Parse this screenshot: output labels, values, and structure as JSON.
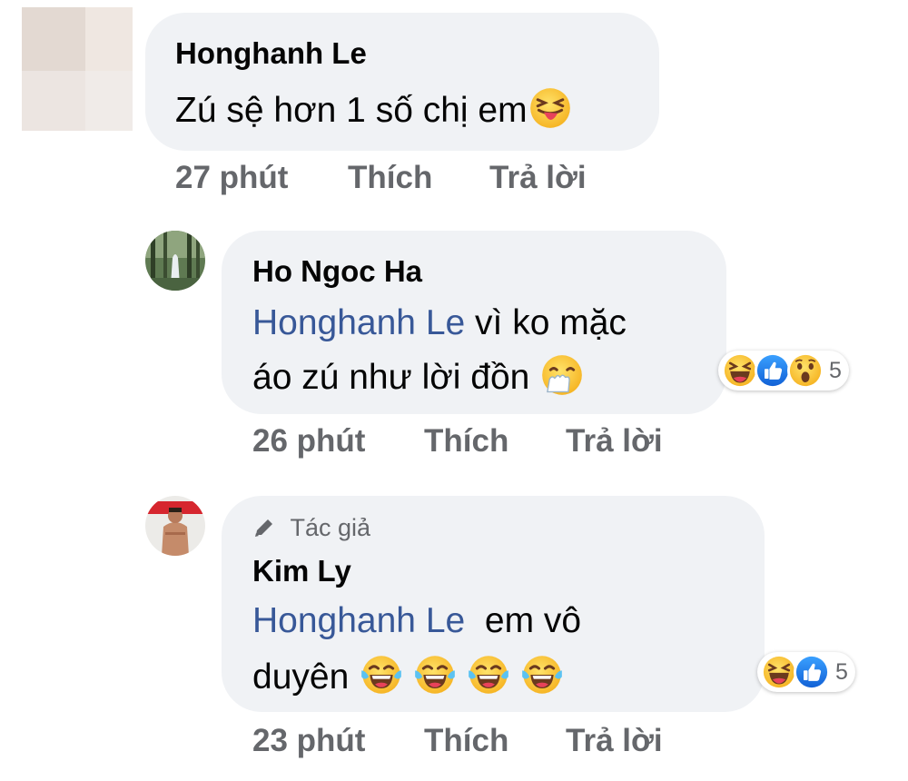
{
  "comments": [
    {
      "author": "Honghanh Le",
      "lines": [
        "Zú sệ hơn 1 số chị em"
      ],
      "emoji": "squinting-tongue-icon",
      "time": "27 phút",
      "like": "Thích",
      "reply": "Trả lời"
    },
    {
      "author": "Ho Ngoc Ha",
      "mention": "Honghanh Le",
      "lines": [
        " vì ko mặc",
        "áo zú  như lời đồn"
      ],
      "emoji": "face-with-hand-over-mouth-icon",
      "reactions": [
        "haha-icon",
        "like-icon",
        "wow-icon"
      ],
      "reaction_count": "5",
      "time": "26 phút",
      "like": "Thích",
      "reply": "Trả lời"
    },
    {
      "badge": "Tác giả",
      "author": "Kim Ly",
      "mention": "Honghanh Le",
      "lines": [
        "  em vô",
        "duyên"
      ],
      "emoji": "tears-of-joy-icon",
      "reactions": [
        "haha-icon",
        "like-icon"
      ],
      "reaction_count": "5",
      "time": "23 phút",
      "like": "Thích",
      "reply": "Trả lời"
    }
  ],
  "colors": {
    "mention": "#385898",
    "bubble": "#f0f2f5",
    "meta": "#65676b",
    "like_blue": "#1877f2",
    "emoji_yellow": "#ffcc4d"
  }
}
